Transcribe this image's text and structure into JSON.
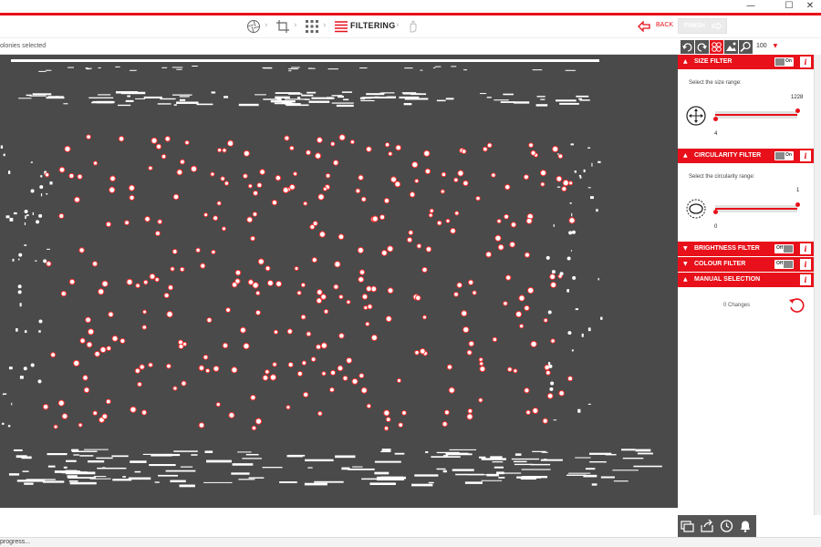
{
  "window": {
    "minimize_glyph": "—",
    "maximize_glyph": "☐",
    "close_glyph": "✕"
  },
  "header": {
    "steps": [
      {
        "name": "aperture-icon"
      },
      {
        "name": "crop-icon"
      },
      {
        "name": "grid-icon"
      },
      {
        "name": "filter-icon",
        "label": "FILTERING"
      },
      {
        "name": "hand-icon"
      }
    ],
    "back_label": "BACK",
    "finish_label": "FINISH"
  },
  "subbar": {
    "selection_text": "olonies selected"
  },
  "toolbar": {
    "zoom_value": "100",
    "icons": [
      "undo-icon",
      "redo-icon",
      "colonies-icon",
      "image-icon",
      "zoom-icon"
    ]
  },
  "panel": {
    "size_filter": {
      "title": "SIZE FILTER",
      "toggle": "On",
      "prompt": "Select the size range:",
      "max": "1228",
      "min": "4"
    },
    "circularity_filter": {
      "title": "CIRCULARITY FILTER",
      "toggle": "On",
      "prompt": "Select the circularity range:",
      "max": "1",
      "min": "0"
    },
    "brightness_filter": {
      "title": "BRIGHTNESS FILTER",
      "toggle": "Off"
    },
    "colour_filter": {
      "title": "COLOUR FILTER",
      "toggle": "Off"
    },
    "manual_selection": {
      "title": "MANUAL SELECTION",
      "changes": "0 Changes"
    },
    "info_glyph": "i"
  },
  "bottom_tools": [
    "layers-icon",
    "export-icon",
    "history-icon",
    "bell-icon"
  ],
  "status": {
    "text": "progress..."
  },
  "colors": {
    "accent": "#e8101a",
    "canvas": "#4a4a4a"
  }
}
